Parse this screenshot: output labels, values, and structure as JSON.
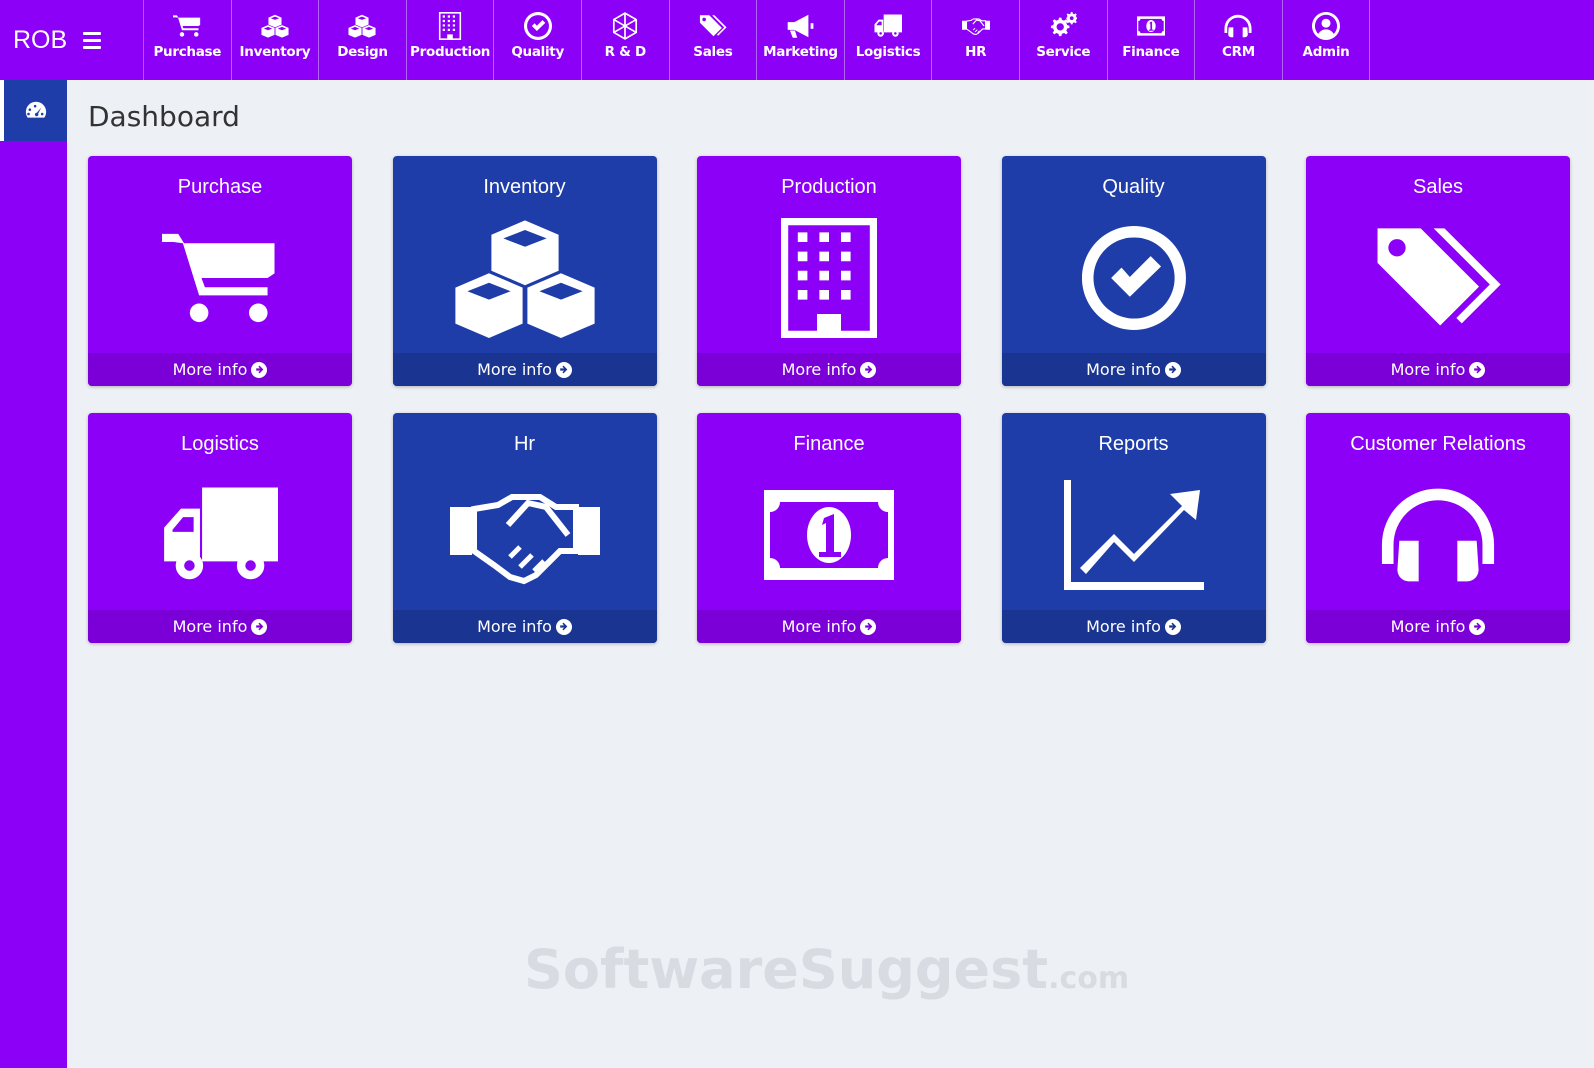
{
  "brand": {
    "name": "ROB"
  },
  "nav": [
    {
      "label": "Purchase",
      "icon": "cart-icon"
    },
    {
      "label": "Inventory",
      "icon": "cubes-icon"
    },
    {
      "label": "Design",
      "icon": "cubes-icon"
    },
    {
      "label": "Production",
      "icon": "building-icon"
    },
    {
      "label": "Quality",
      "icon": "check-circle-icon"
    },
    {
      "label": "R & D",
      "icon": "hexagon-network-icon"
    },
    {
      "label": "Sales",
      "icon": "tags-icon"
    },
    {
      "label": "Marketing",
      "icon": "megaphone-icon"
    },
    {
      "label": "Logistics",
      "icon": "truck-icon"
    },
    {
      "label": "HR",
      "icon": "handshake-icon"
    },
    {
      "label": "Service",
      "icon": "gears-icon"
    },
    {
      "label": "Finance",
      "icon": "money-bill-icon"
    },
    {
      "label": "CRM",
      "icon": "headphones-icon"
    },
    {
      "label": "Admin",
      "icon": "user-circle-icon"
    }
  ],
  "sidebar": {
    "active_icon": "dashboard-icon"
  },
  "page": {
    "title": "Dashboard"
  },
  "tiles": [
    {
      "title": "Purchase",
      "icon": "cart-icon",
      "color": "#8d00f7",
      "more": "More info"
    },
    {
      "title": "Inventory",
      "icon": "cubes-icon",
      "color": "#1e3da8",
      "more": "More info"
    },
    {
      "title": "Production",
      "icon": "building-icon",
      "color": "#8d00f7",
      "more": "More info"
    },
    {
      "title": "Quality",
      "icon": "check-circle-icon",
      "color": "#1e3da8",
      "more": "More info"
    },
    {
      "title": "Sales",
      "icon": "tags-icon",
      "color": "#8d00f7",
      "more": "More info"
    },
    {
      "title": "Logistics",
      "icon": "truck-icon",
      "color": "#8d00f7",
      "more": "More info"
    },
    {
      "title": "Hr",
      "icon": "handshake-icon",
      "color": "#1e3da8",
      "more": "More info"
    },
    {
      "title": "Finance",
      "icon": "money-bill-icon",
      "color": "#8d00f7",
      "more": "More info"
    },
    {
      "title": "Reports",
      "icon": "line-chart-icon",
      "color": "#1e3da8",
      "more": "More info"
    },
    {
      "title": "Customer Relations",
      "icon": "headphones-icon",
      "color": "#8d00f7",
      "more": "More info"
    }
  ],
  "watermark": {
    "main": "SoftwareSuggest",
    "suffix": ".com"
  },
  "colors": {
    "purple": "#8d00f7",
    "blue": "#1e3da8",
    "background": "#edf0f5"
  }
}
